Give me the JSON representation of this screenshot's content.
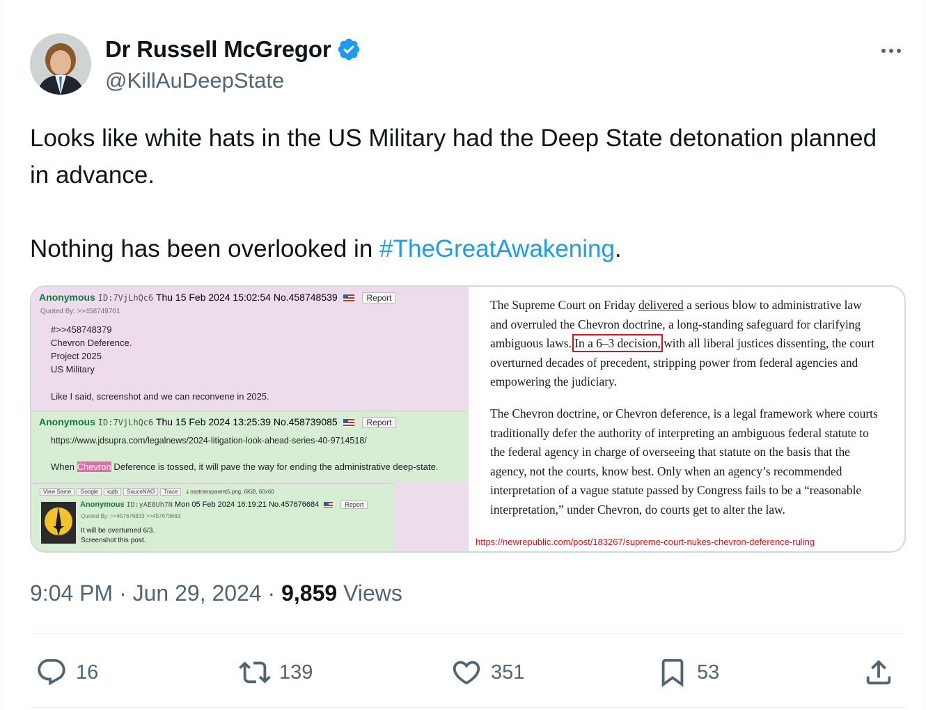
{
  "author": {
    "name": "Dr Russell McGregor",
    "handle": "@KillAuDeepState",
    "verified": true
  },
  "tweet": {
    "line1": "Looks like white hats in the US Military had the Deep State detonation planned in advance.",
    "line2_prefix": "Nothing has been overlooked in ",
    "hashtag": "#TheGreatAwakening",
    "line2_suffix": "."
  },
  "media": {
    "post1": {
      "name": "Anonymous",
      "id": "ID:7VjLhQc6",
      "datetime": "Thu 15 Feb 2024 15:02:54",
      "number": "No.458748539",
      "report": "Report",
      "quoted_by": "Quoted By: >>458749701",
      "lines": [
        "#>>458748379",
        "Chevron Deference.",
        "Project 2025",
        "US Military"
      ],
      "footer": "Like I said, screenshot and we can reconvene in 2025."
    },
    "post2": {
      "name": "Anonymous",
      "id": "ID:7VjLhQc6",
      "datetime": "Thu 15 Feb 2024 13:25:39",
      "number": "No.458739085",
      "report": "Report",
      "link": "https://www.jdsupra.com/legalnews/2024-litigation-look-ahead-series-40-9714518/",
      "text_prefix": "When ",
      "highlight": "Chevron",
      "text_suffix": " Deference is tossed, it will pave the way for ending the administrative deep-state."
    },
    "post3": {
      "toolbar": [
        "View Same",
        "Google",
        "iqdb",
        "SauceNAO",
        "Trace",
        "⤓  osstransparent5.png, 6KiB, 60x60"
      ],
      "name": "Anonymous",
      "id": "ID:yAE8Uh7N",
      "datetime": "Mon 05 Feb 2024 16:19:21",
      "number": "No.457676684",
      "report": "Report",
      "quoted_by": "Quoted By: >>457676833 >>457679683",
      "line1": "It will be overturned 6/3.",
      "line2": "Screenshot this post."
    },
    "article": {
      "p1_a": "The Supreme Court on Friday ",
      "p1_link": "delivered",
      "p1_b": " a serious blow to administrative law and overruled the Chevron doctrine, a long-standing safeguard for clarifying ambiguous laws. ",
      "p1_boxed": "In a 6–3 decision,",
      "p1_c": " with all liberal justices dissenting, the court overturned decades of precedent, stripping power from federal agencies and empowering the judiciary.",
      "p2": "The Chevron doctrine, or Chevron deference, is a legal framework where courts traditionally defer the authority of interpreting an ambiguous federal statute to the federal agency in charge of overseeing that statute on the basis that the agency, not the courts, know best. Only when an agency’s recommended interpretation of a vague statute passed by Congress fails to be a “reasonable interpretation,” under Chevron, do courts get to alter the law.",
      "source_url": "https://newrepublic.com/post/183267/supreme-court-nukes-chevron-deference-ruling"
    }
  },
  "meta": {
    "time": "9:04 PM",
    "sep": " · ",
    "date": "Jun 29, 2024",
    "views_count": "9,859",
    "views_label": " Views"
  },
  "actions": {
    "replies": "16",
    "reposts": "139",
    "likes": "351",
    "bookmarks": "53"
  },
  "colors": {
    "accent": "#1d9bf0",
    "text": "#0f1419",
    "muted": "#536471"
  }
}
